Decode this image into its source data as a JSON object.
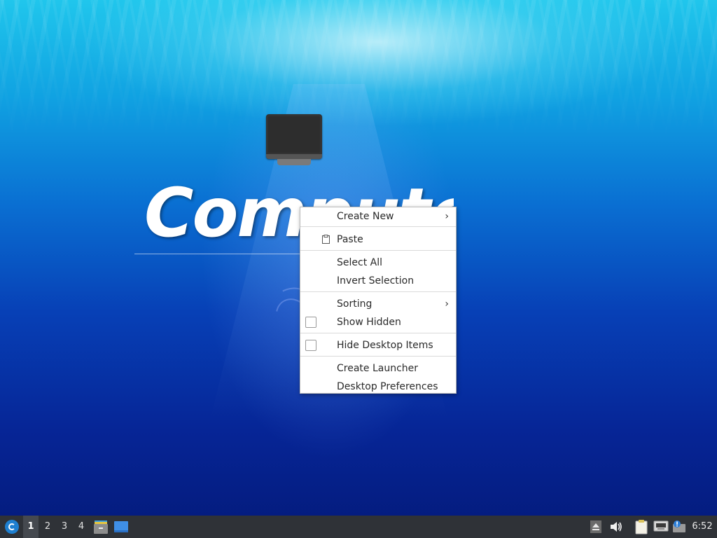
{
  "desktop": {
    "icon_label": "Computer"
  },
  "context_menu": {
    "items": [
      {
        "label": "Create New",
        "submenu": true
      },
      {
        "label": "Paste",
        "icon": "paste-icon"
      },
      {
        "label": "Select All"
      },
      {
        "label": "Invert Selection"
      },
      {
        "label": "Sorting",
        "submenu": true
      },
      {
        "label": "Show Hidden",
        "checkbox": true,
        "checked": false
      },
      {
        "label": "Hide Desktop Items",
        "checkbox": true,
        "checked": false
      },
      {
        "label": "Create Launcher"
      },
      {
        "label": "Desktop Preferences"
      }
    ],
    "submenu_arrow": "›"
  },
  "taskbar": {
    "workspaces": [
      "1",
      "2",
      "3",
      "4"
    ],
    "active_workspace": "1",
    "launchers": [
      "file-manager-icon",
      "show-desktop-icon"
    ],
    "tray": [
      "eject-icon",
      "volume-icon",
      "clipboard-icon",
      "network-icon",
      "update-notifier-icon"
    ],
    "clock": "6:52"
  },
  "colors": {
    "taskbar_bg": "#2f3237",
    "menu_bg": "#ffffff",
    "accent": "#1e7fd0"
  }
}
